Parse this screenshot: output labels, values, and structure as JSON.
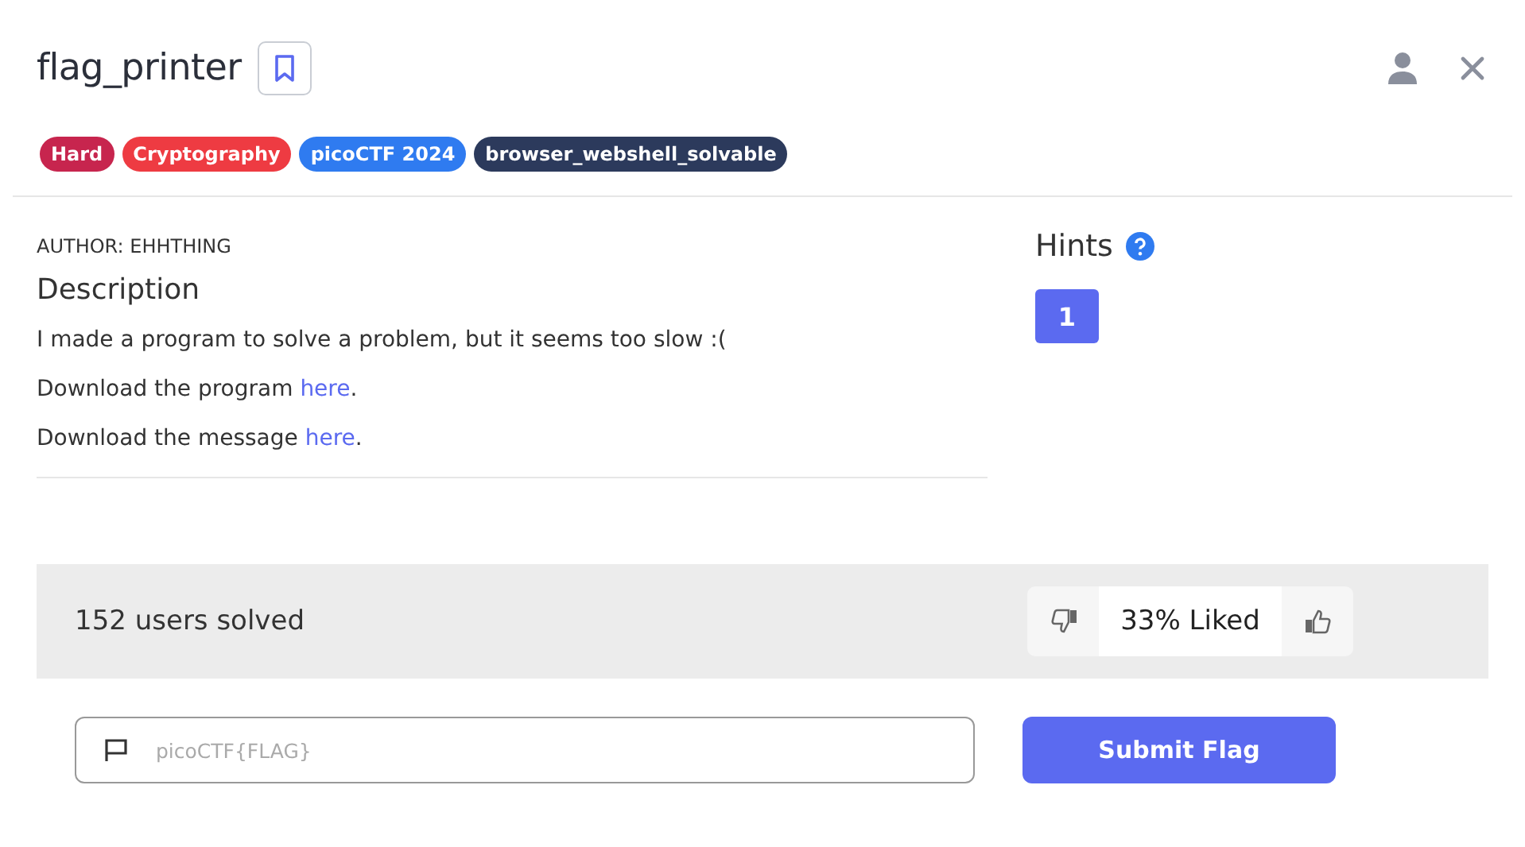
{
  "title": "flag_printer",
  "tags": [
    {
      "label": "Hard",
      "color": "#c7254e"
    },
    {
      "label": "Cryptography",
      "color": "#ee3b42"
    },
    {
      "label": "picoCTF 2024",
      "color": "#2f7bf0"
    },
    {
      "label": "browser_webshell_solvable",
      "color": "#2c3a5c"
    }
  ],
  "author": "AUTHOR: EHHTHING",
  "description_heading": "Description",
  "description": [
    {
      "text": "I made a program to solve a problem, but it seems too slow :("
    },
    {
      "text": "Download the program ",
      "link": "here",
      "after": "."
    },
    {
      "text": "Download the message ",
      "link": "here",
      "after": "."
    }
  ],
  "hints": {
    "heading": "Hints",
    "buttons": [
      "1"
    ]
  },
  "solved": "152 users solved",
  "liked": "33% Liked",
  "flag_field": {
    "placeholder": "picoCTF{FLAG}"
  },
  "submit": "Submit Flag"
}
